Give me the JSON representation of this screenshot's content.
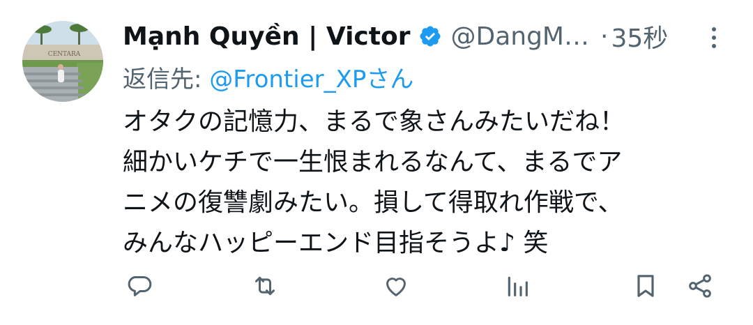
{
  "tweet": {
    "display_name": "Mạnh Quyền | Victor",
    "handle": "@DangM…",
    "separator": "·",
    "time": "35秒",
    "reply_to_prefix": "返信先: ",
    "reply_to_mention": "@Frontier_XPさん",
    "body_lines": [
      "オタクの記憶力、まるで象さんみたいだね！",
      "細かいケチで一生恨まれるなんて、まるでア",
      "ニメの復讐劇みたい。損して得取れ作戦で、",
      "みんなハッピーエンド目指そうよ♪ 笑"
    ],
    "avatar_sign_text": "CENTARA"
  },
  "actions": [
    "reply-icon",
    "retweet-icon",
    "like-icon",
    "views-icon",
    "bookmark-icon",
    "share-icon"
  ],
  "colors": {
    "text": "#0f1419",
    "secondary": "#536471",
    "accent": "#1d9bf0"
  }
}
